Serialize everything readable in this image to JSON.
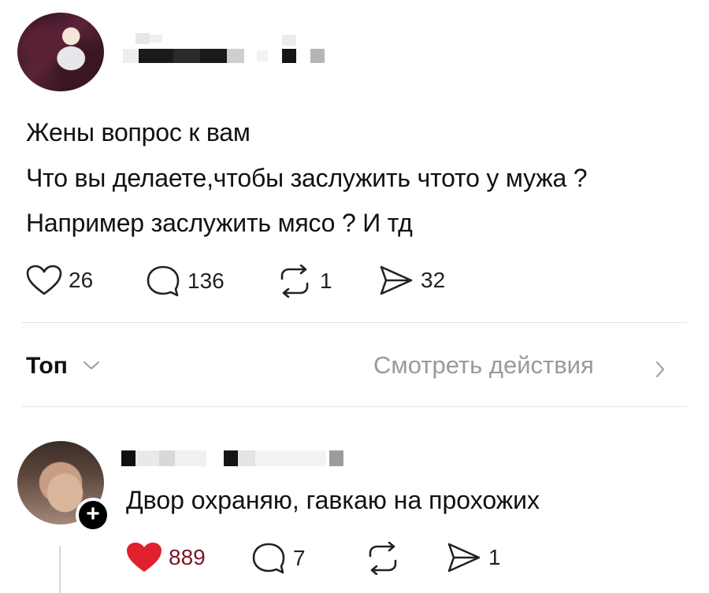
{
  "post": {
    "lines": [
      "Жены вопрос к вам",
      "Что вы делаете,чтобы заслужить чтото у мужа ?",
      "Например заслужить мясо ? И тд"
    ],
    "actions": {
      "likes": "26",
      "comments": "136",
      "reposts": "1",
      "shares": "32"
    }
  },
  "replies_header": {
    "sort_label": "Топ",
    "activity_link": "Смотреть действия"
  },
  "reply": {
    "text": "Двор охраняю, гавкаю на прохожих",
    "follow_symbol": "+",
    "actions": {
      "likes": "889",
      "comments": "7",
      "shares": "1"
    },
    "liked": true
  },
  "colors": {
    "like_red": "#e0202e",
    "muted_text": "#9a9a9a",
    "divider": "#e3e3e3"
  },
  "icons": [
    "heart-icon",
    "comment-icon",
    "repost-icon",
    "share-icon",
    "chevron-down-icon",
    "chevron-right-icon",
    "plus-icon"
  ]
}
